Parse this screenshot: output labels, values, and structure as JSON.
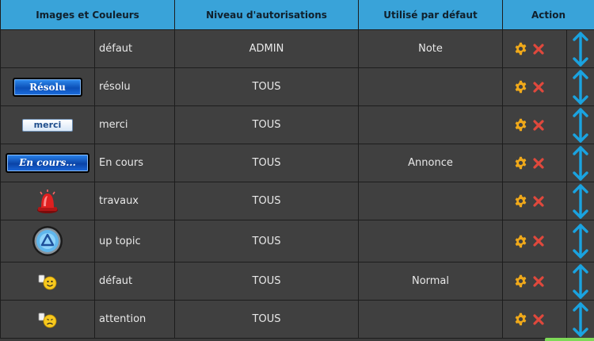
{
  "headers": {
    "images": "Images et Couleurs",
    "level": "Niveau d'autorisations",
    "default_use": "Utilisé par défaut",
    "action": "Action"
  },
  "rows": [
    {
      "image": "",
      "name": "défaut",
      "level": "ADMIN",
      "default": "Note"
    },
    {
      "image_text": "Résolu",
      "name": "résolu",
      "level": "TOUS",
      "default": ""
    },
    {
      "image_text": "merci",
      "name": "merci",
      "level": "TOUS",
      "default": ""
    },
    {
      "image_text": "En cours...",
      "name": "En cours",
      "level": "TOUS",
      "default": "Annonce"
    },
    {
      "image": "siren-icon",
      "name": "travaux",
      "level": "TOUS",
      "default": ""
    },
    {
      "image": "up-button-icon",
      "name": "up topic",
      "level": "TOUS",
      "default": ""
    },
    {
      "image": "smiley-icon",
      "name": "défaut",
      "level": "TOUS",
      "default": "Normal"
    },
    {
      "image": "worried-smiley-icon",
      "name": "attention",
      "level": "TOUS",
      "default": ""
    }
  ],
  "icons": {
    "edit": "gear-icon",
    "delete": "close-icon",
    "move": "up-down-arrow-icon"
  },
  "colors": {
    "header_bg": "#39a3d9",
    "row_bg": "#404040",
    "gear": "#f0a91a",
    "delete": "#e0483c",
    "arrow": "#1aa3e0"
  }
}
